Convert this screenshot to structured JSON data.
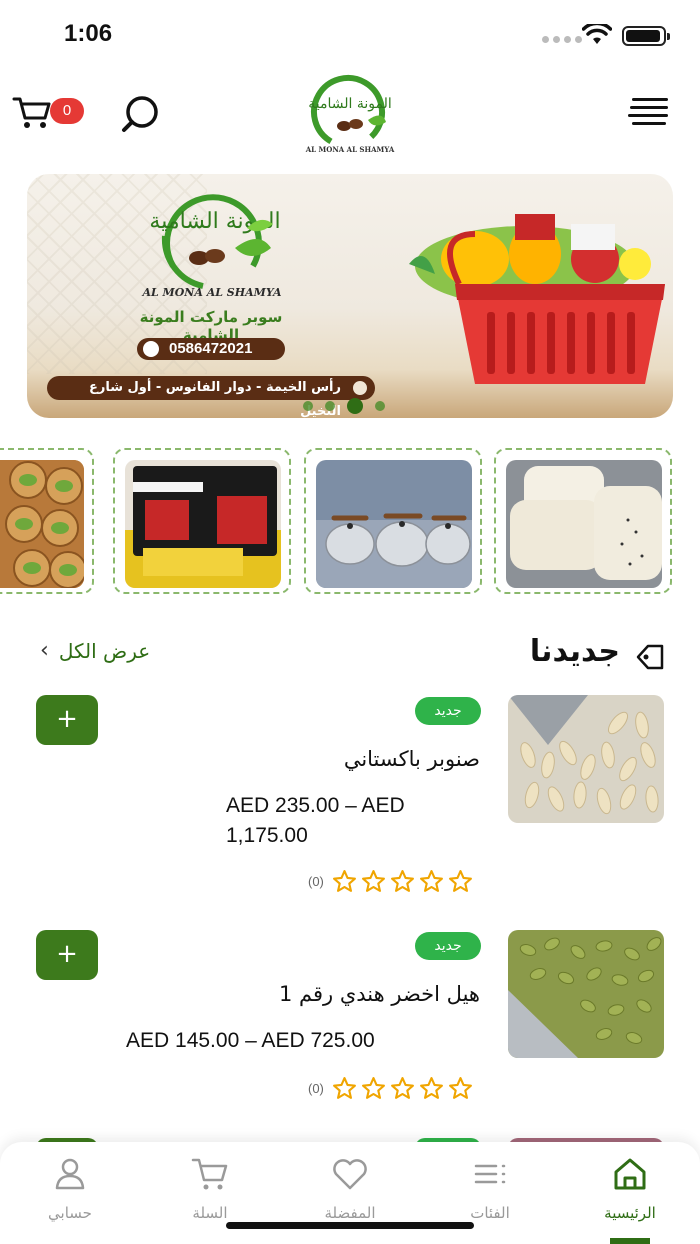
{
  "status_bar": {
    "time": "1:06"
  },
  "header": {
    "cart_count": "0",
    "logo_text": "المونة الشامية",
    "logo_subtext": "AL MONA AL SHAMYA"
  },
  "banner": {
    "logo_text": "المونة الشامية",
    "brand": "AL MONA AL SHAMYA",
    "subtitle": "سوبر ماركت المونة الشامية",
    "phone": "0586472021",
    "address": "رأس الخيمة - دوار الفانوس - أول شارع النخيل",
    "active_slide": 3,
    "slide_count": 4
  },
  "section": {
    "title": "جديدنا",
    "view_all": "عرض الكل"
  },
  "products": [
    {
      "badge": "جديد",
      "name": "صنوبر باكستاني",
      "price": "AED 235.00 – AED 1,175.00",
      "rating_count": "(0)",
      "add_label": "+"
    },
    {
      "badge": "جديد",
      "name": "هيل اخضر هندي رقم 1",
      "price": "AED 145.00 – AED 725.00",
      "rating_count": "(0)",
      "add_label": "+"
    }
  ],
  "nav": {
    "home": "الرئيسية",
    "categories": "الفئات",
    "favorites": "المفضلة",
    "cart": "السلة",
    "account": "حسابي"
  },
  "colors": {
    "brand_green": "#2f6d15",
    "badge_green": "#2fb34a",
    "cart_badge_red": "#e53935",
    "banner_brown": "#5a2d14"
  }
}
